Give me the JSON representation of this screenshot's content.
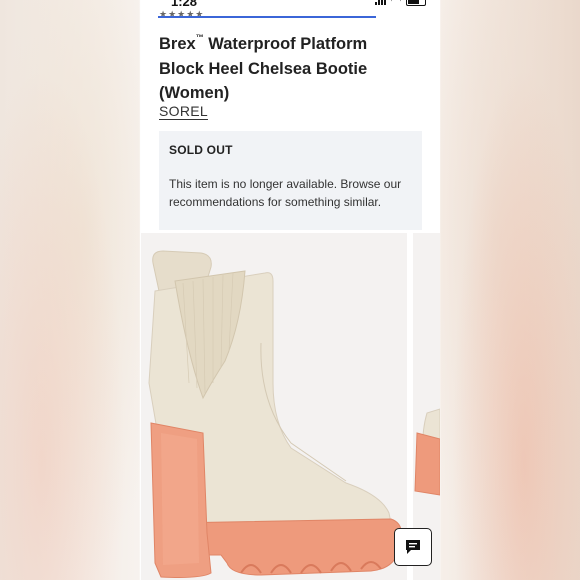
{
  "status_bar": {
    "time": "1:28"
  },
  "product": {
    "title_part1": "Brex",
    "trademark": "™",
    "title_part2": " Waterproof Platform Block Heel Chelsea Bootie (Women)",
    "brand": "SOREL"
  },
  "availability": {
    "status": "SOLD OUT",
    "message": "This item is no longer available. Browse our recommendations for something similar."
  },
  "colors": {
    "accent": "#3b66d8",
    "boot_upper": "#ebe4d4",
    "boot_sole": "#ee9a7c",
    "notice_bg": "#f1f3f6"
  },
  "icons": {
    "chat": "chat-icon",
    "boot_image": "boot-photo"
  }
}
